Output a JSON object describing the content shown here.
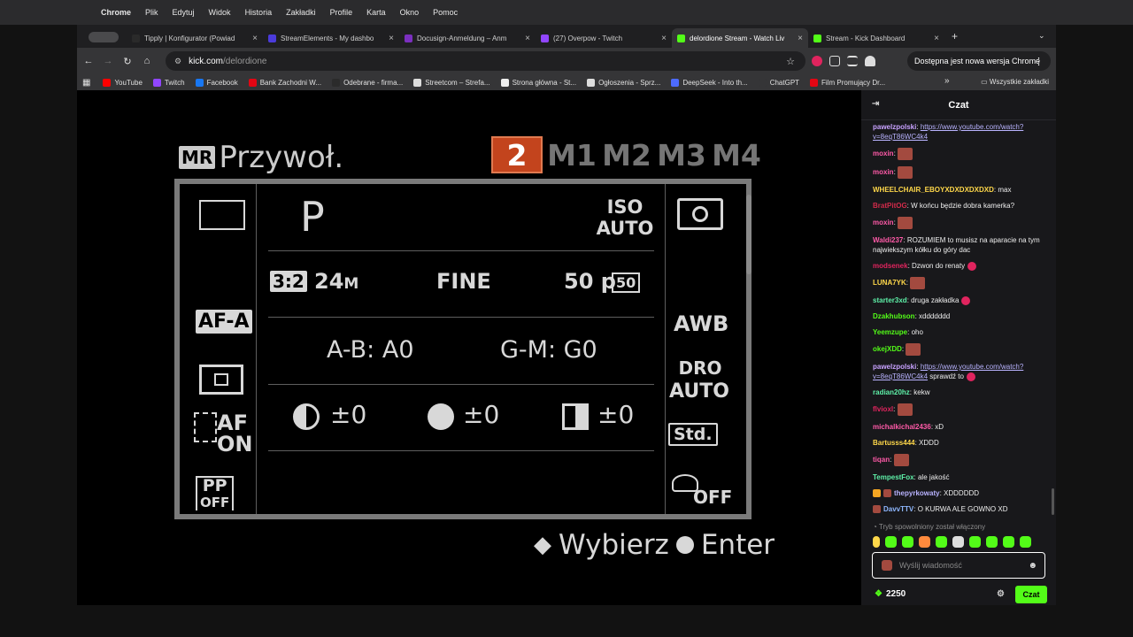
{
  "macmenu": {
    "app": "Chrome",
    "items": [
      "Plik",
      "Edytuj",
      "Widok",
      "Historia",
      "Zakładki",
      "Profile",
      "Karta",
      "Okno",
      "Pomoc"
    ]
  },
  "tabs": [
    {
      "title": "Tipply | Konfigurator (Powiad",
      "color": "#2a2a2a"
    },
    {
      "title": "StreamElements - My dashbo",
      "color": "#4b3bdb"
    },
    {
      "title": "Docusign-Anmeldung – Anm",
      "color": "#7b2fbf"
    },
    {
      "title": "(27) Overpow - Twitch",
      "color": "#9146ff"
    },
    {
      "title": "delordione Stream - Watch Liv",
      "color": "#53fc18",
      "active": true
    },
    {
      "title": "Stream - Kick Dashboard",
      "color": "#53fc18"
    }
  ],
  "url": {
    "host": "kick.com",
    "path": "/delordione"
  },
  "update_label": "Dostępna jest nowa wersja Chrome",
  "bookmarks": [
    {
      "label": "YouTube",
      "color": "#ff0000"
    },
    {
      "label": "Twitch",
      "color": "#9146ff"
    },
    {
      "label": "Facebook",
      "color": "#1877f2"
    },
    {
      "label": "Bank Zachodni W...",
      "color": "#e30613"
    },
    {
      "label": "Odebrane - firma...",
      "color": "#2b2b2b"
    },
    {
      "label": "Streetcom – Strefa...",
      "color": "#dddddd"
    },
    {
      "label": "Strona główna - St...",
      "color": "#eeeeee"
    },
    {
      "label": "Ogłoszenia - Sprz...",
      "color": "#dddddd"
    },
    {
      "label": "DeepSeek - Into th...",
      "color": "#4d6bfe"
    },
    {
      "label": "ChatGPT",
      "color": "#353537"
    },
    {
      "label": "Film Promujący Dr...",
      "color": "#e30613"
    }
  ],
  "bookmarks_all": "Wszystkie zakładki",
  "camera": {
    "title": "Przywoł.",
    "mr": "MR",
    "memories": [
      "2",
      "M1",
      "M2",
      "M3",
      "M4"
    ],
    "mode": "P",
    "iso_line1": "ISO",
    "iso_line2": "AUTO",
    "aspect": "3:2",
    "size": "24",
    "size_unit": "M",
    "quality": "FINE",
    "framerate": "50",
    "framerate_unit": "p",
    "framerate_box": "50",
    "afa": "AF-A",
    "awb": "AWB",
    "ab": "A-B: A0",
    "gm": "G-M: G0",
    "dro_line1": "DRO",
    "dro_line2": "AUTO",
    "contrast": "±0",
    "saturation": "±0",
    "sharpness": "±0",
    "af_on_1": "AF",
    "af_on_2": "ON",
    "creative": "Std.",
    "pp_1": "PP",
    "pp_2": "OFF",
    "picture_effect": "OFF",
    "hint_select": "Wybierz",
    "hint_enter": "Enter"
  },
  "chat": {
    "title": "Czat",
    "messages": [
      {
        "user": "pawelzpolski",
        "color": "#c8a2ff",
        "link": "https://www.youtube.com/watch?v=8eqT86WC4k4",
        "text": ""
      },
      {
        "user": "moxin",
        "color": "#ff5aa8",
        "emote": true
      },
      {
        "user": "moxin",
        "color": "#ff5aa8",
        "emote": true
      },
      {
        "user": "WHEELCHAIR_EBOYXDXDXDXDXD",
        "color": "#ffd84a",
        "text": "max"
      },
      {
        "user": "BratPitOG",
        "color": "#d22b4a",
        "text": "W końcu będzie dobra kamerka?"
      },
      {
        "user": "moxin",
        "color": "#ff5aa8",
        "emote": true
      },
      {
        "user": "Waldi237",
        "color": "#ff5aa8",
        "text": "ROZUMIEM to musisz na aparacie na tym najwiekszym kółku do góry dac"
      },
      {
        "user": "modsenek",
        "color": "#e0245e",
        "text": "Dzwon do renaty",
        "heart": true
      },
      {
        "user": "LUNA7YK",
        "color": "#ffd84a",
        "emote": true
      },
      {
        "user": "starter3xd",
        "color": "#5ef0a8",
        "text": "druga zakładka",
        "heart": true
      },
      {
        "user": "Dzakhubson",
        "color": "#53fc18",
        "text": "xddddddd"
      },
      {
        "user": "Yeemzupe",
        "color": "#53fc18",
        "text": "oho"
      },
      {
        "user": "okejXDD",
        "color": "#53fc18",
        "emote": true
      },
      {
        "user": "pawelzpolski",
        "color": "#c8a2ff",
        "link": "https://www.youtube.com/watch?v=8eqT86WC4k4",
        "text": "sprawdź to",
        "heart": true
      },
      {
        "user": "radian20hz",
        "color": "#5ef0a8",
        "text": "kekw"
      },
      {
        "user": "flvioxl",
        "color": "#e0245e",
        "emote": true
      },
      {
        "user": "michalkichal2436",
        "color": "#ff5aa8",
        "text": "xD"
      },
      {
        "user": "Bartusss444",
        "color": "#ffd84a",
        "text": "XDDD"
      },
      {
        "user": "tiqan",
        "color": "#ff5aa8",
        "emote": true
      },
      {
        "user": "TempestFox",
        "color": "#5ef0a8",
        "text": "ale jakość"
      },
      {
        "user": "thepyrkowaty",
        "color": "#b9b3ff",
        "text": "XDDDDDD",
        "badges": [
          "#f5a623",
          "#a34a3f"
        ]
      },
      {
        "user": "DavvTTV",
        "color": "#8fb8ff",
        "text": "O KURWA ALE GOWNO XD",
        "badges": [
          "#a34a3f"
        ]
      }
    ],
    "slowmode": "Tryb spowolniony został włączony",
    "placeholder": "Wyślij wiadomość",
    "points": "2250",
    "send_label": "Czat"
  }
}
